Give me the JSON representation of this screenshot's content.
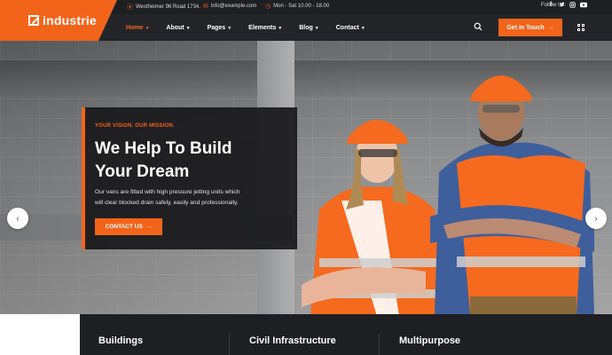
{
  "brand": {
    "name": "industrie",
    "accent": "#f3641b"
  },
  "topbar": {
    "address": "Westheimer 96 Road 1734.",
    "email": "info@example.com",
    "hours": "Mon - Sat 10.00 - 18.00",
    "follow_label": "Follow Us:",
    "socials": [
      "f",
      "t",
      "ig",
      "yt"
    ]
  },
  "nav": {
    "items": [
      {
        "label": "Home",
        "dropdown": true,
        "active": true
      },
      {
        "label": "About",
        "dropdown": true
      },
      {
        "label": "Pages",
        "dropdown": true
      },
      {
        "label": "Elements",
        "dropdown": true
      },
      {
        "label": "Blog",
        "dropdown": true
      },
      {
        "label": "Contact",
        "dropdown": true
      }
    ],
    "cta_label": "Get In Touch",
    "icons": [
      "search-icon",
      "grid-menu-icon"
    ]
  },
  "hero": {
    "eyebrow": "YOUR VISION. OUR MISSION.",
    "title_line1": "We Help To Build",
    "title_line2": "Your Dream",
    "text_line1": "Our vans are fitted with high pressure jetting units which",
    "text_line2": "will clear blocked drain safely, easily and professionally.",
    "button_label": "CONTACT US",
    "prev_icon": "chevron-left-icon",
    "next_icon": "chevron-right-icon"
  },
  "services": [
    "Buildings",
    "Civil Infrastructure",
    "Multipurpose"
  ]
}
